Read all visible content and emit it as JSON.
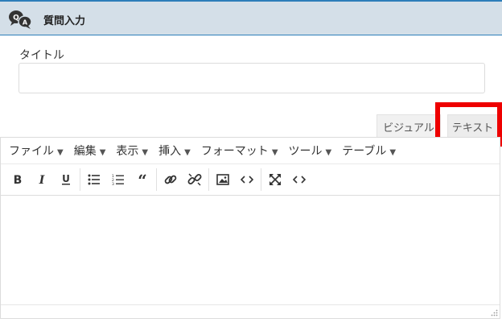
{
  "header": {
    "title": "質問入力",
    "icon": "qa-chat-icon"
  },
  "form": {
    "title_label": "タイトル",
    "title_value": "",
    "title_placeholder": ""
  },
  "tabs": [
    {
      "label": "ビジュアル",
      "active": false
    },
    {
      "label": "テキスト",
      "active": true
    }
  ],
  "highlight_color": "#ee0000",
  "menubar": {
    "items": [
      "ファイル",
      "編集",
      "表示",
      "挿入",
      "フォーマット",
      "ツール",
      "テーブル"
    ]
  },
  "toolbar": {
    "buttons": [
      "bold-icon",
      "italic-icon",
      "underline-icon",
      "bullet-list-icon",
      "numbered-list-icon",
      "blockquote-icon",
      "link-icon",
      "unlink-icon",
      "image-icon",
      "code-icon",
      "fullscreen-icon",
      "source-code-icon"
    ]
  },
  "colors": {
    "header_bg": "#d4dfe8",
    "header_border": "#2d7eb9"
  }
}
